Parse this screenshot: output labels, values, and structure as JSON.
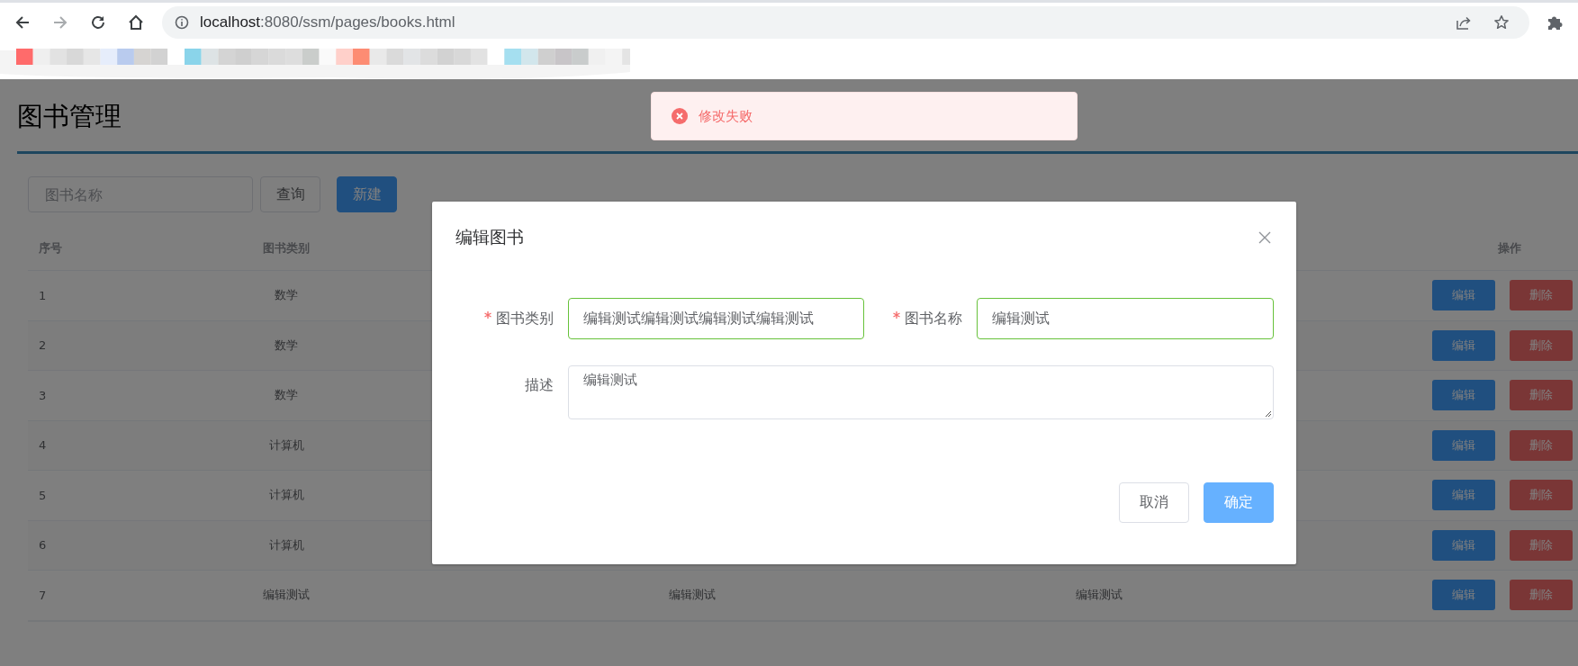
{
  "browser": {
    "nav": {
      "forward_disabled": true
    },
    "url": {
      "host": "localhost",
      "path": ":8080/ssm/pages/books.html"
    }
  },
  "page": {
    "title": "图书管理",
    "search": {
      "placeholder": "图书名称"
    },
    "toolbar_buttons": [
      {
        "label": "查询",
        "kind": "default"
      },
      {
        "label": "新建",
        "kind": "primary"
      }
    ],
    "table": {
      "header": {
        "index": "序号",
        "category": "图书类别",
        "actions": "操作"
      },
      "rows": [
        {
          "index": "1",
          "category": "数学",
          "actions": [
            {
              "label": "编辑",
              "kind": "primary"
            },
            {
              "label": "删除",
              "kind": "danger"
            }
          ]
        },
        {
          "index": "2",
          "category": "数学",
          "actions": [
            {
              "label": "编辑",
              "kind": "primary"
            },
            {
              "label": "删除",
              "kind": "danger"
            }
          ]
        },
        {
          "index": "3",
          "category": "数学",
          "actions": [
            {
              "label": "编辑",
              "kind": "primary"
            },
            {
              "label": "删除",
              "kind": "danger"
            }
          ]
        },
        {
          "index": "4",
          "category": "计算机",
          "actions": [
            {
              "label": "编辑",
              "kind": "primary"
            },
            {
              "label": "删除",
              "kind": "danger"
            }
          ]
        },
        {
          "index": "5",
          "category": "计算机",
          "actions": [
            {
              "label": "编辑",
              "kind": "primary"
            },
            {
              "label": "删除",
              "kind": "danger"
            }
          ]
        },
        {
          "index": "6",
          "category": "计算机",
          "actions": [
            {
              "label": "编辑",
              "kind": "primary"
            },
            {
              "label": "删除",
              "kind": "danger"
            }
          ]
        },
        {
          "index": "7",
          "category": "编辑测试",
          "column_3": "编辑测试",
          "column_4": "编辑测试",
          "actions": [
            {
              "label": "编辑",
              "kind": "primary"
            },
            {
              "label": "删除",
              "kind": "danger"
            }
          ]
        }
      ]
    }
  },
  "message": {
    "kind": "error",
    "text": "修改失败"
  },
  "dialog": {
    "title": "编辑图书",
    "fields": [
      {
        "kind": "input",
        "label": "图书类别",
        "required": true,
        "validated": true,
        "value": "编辑测试编辑测试编辑测试编辑测试"
      },
      {
        "kind": "input",
        "label": "图书名称",
        "required": true,
        "validated": true,
        "value": "编辑测试"
      },
      {
        "kind": "textarea",
        "label": "描述",
        "required": false,
        "validated": false,
        "value": "编辑测试"
      }
    ],
    "buttons": [
      {
        "label": "取消",
        "kind": "default",
        "highlighted": false
      },
      {
        "label": "确定",
        "kind": "primary",
        "highlighted": true
      }
    ]
  }
}
